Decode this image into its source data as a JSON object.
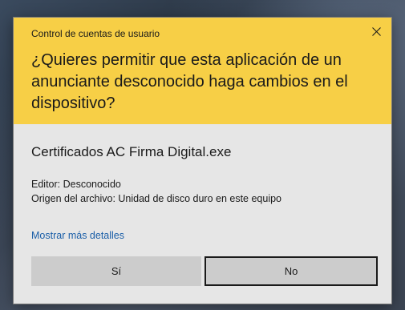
{
  "dialog": {
    "window_title": "Control de cuentas de usuario",
    "question": "¿Quieres permitir que esta aplicación de un anunciante desconocido haga cambios en el dispositivo?",
    "app_name": "Certificados AC Firma Digital.exe",
    "publisher": "Editor: Desconocido",
    "file_origin": "Origen del archivo: Unidad de disco duro en este equipo",
    "more_details_link": "Mostrar más detalles",
    "yes_label": "Sí",
    "no_label": "No",
    "close_icon": "close-icon"
  },
  "colors": {
    "header_background": "#f7cf46",
    "body_background": "#e6e6e6",
    "button_background": "#cccccc",
    "link": "#1b5fa8"
  }
}
